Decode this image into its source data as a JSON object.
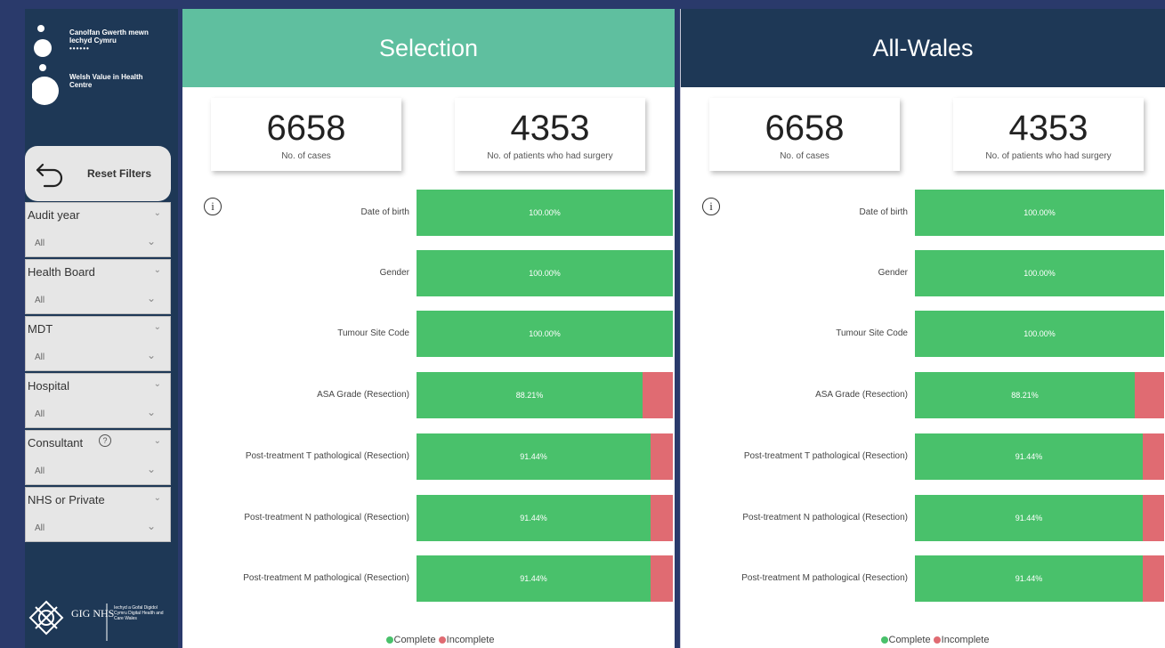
{
  "logo": {
    "welsh_name": "Canolfan Gwerth mewn Iechyd Cymru",
    "dots": "••••••",
    "english_name": "Welsh Value in Health Centre"
  },
  "reset_filters": "Reset Filters",
  "filters": [
    {
      "title": "Audit year",
      "value": "All"
    },
    {
      "title": "Health Board",
      "value": "All"
    },
    {
      "title": "MDT",
      "value": "All"
    },
    {
      "title": "Hospital",
      "value": "All"
    },
    {
      "title": "Consultant",
      "value": "All"
    },
    {
      "title": "NHS or Private",
      "value": "All"
    }
  ],
  "footer": {
    "nhs_logo": "GIG NHS",
    "nhs_small": "Iechyd a Gofal Digidol Cymru Digital Health and Care Wales"
  },
  "panels": [
    {
      "title": "Selection",
      "cards": [
        {
          "value": "6658",
          "label": "No. of cases"
        },
        {
          "value": "4353",
          "label": "No. of patients who had surgery"
        }
      ],
      "rows": [
        {
          "label": "Date of birth",
          "complete": 100.0,
          "text": "100.00%"
        },
        {
          "label": "Gender",
          "complete": 100.0,
          "text": "100.00%"
        },
        {
          "label": "Tumour Site Code",
          "complete": 100.0,
          "text": "100.00%"
        },
        {
          "label": "ASA Grade (Resection)",
          "complete": 88.21,
          "text": "88.21%"
        },
        {
          "label": "Post-treatment T pathological (Resection)",
          "complete": 91.44,
          "text": "91.44%"
        },
        {
          "label": "Post-treatment N pathological (Resection)",
          "complete": 91.44,
          "text": "91.44%"
        },
        {
          "label": "Post-treatment M pathological (Resection)",
          "complete": 91.44,
          "text": "91.44%"
        }
      ],
      "legend": {
        "complete": "Complete",
        "incomplete": "Incomplete"
      }
    },
    {
      "title": "All-Wales",
      "cards": [
        {
          "value": "6658",
          "label": "No. of cases"
        },
        {
          "value": "4353",
          "label": "No. of patients who had surgery"
        }
      ],
      "rows": [
        {
          "label": "Date of birth",
          "complete": 100.0,
          "text": "100.00%"
        },
        {
          "label": "Gender",
          "complete": 100.0,
          "text": "100.00%"
        },
        {
          "label": "Tumour Site Code",
          "complete": 100.0,
          "text": "100.00%"
        },
        {
          "label": "ASA Grade (Resection)",
          "complete": 88.21,
          "text": "88.21%"
        },
        {
          "label": "Post-treatment T pathological (Resection)",
          "complete": 91.44,
          "text": "91.44%"
        },
        {
          "label": "Post-treatment N pathological (Resection)",
          "complete": 91.44,
          "text": "91.44%"
        },
        {
          "label": "Post-treatment M pathological (Resection)",
          "complete": 91.44,
          "text": "91.44%"
        }
      ],
      "legend": {
        "complete": "Complete",
        "incomplete": "Incomplete"
      }
    }
  ],
  "colors": {
    "complete": "#49c16b",
    "incomplete": "#e06b72",
    "selection_header": "#5fbf9f",
    "all_wales_header": "#1e3856"
  }
}
